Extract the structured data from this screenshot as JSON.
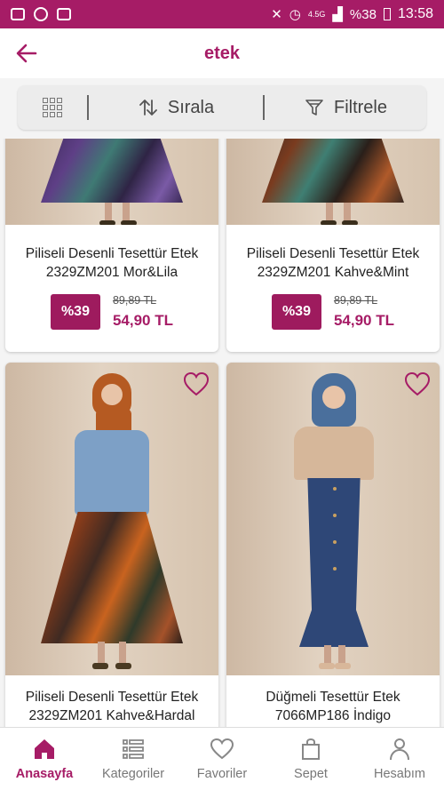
{
  "status_bar": {
    "network": "4.5G",
    "battery": "%38",
    "time": "13:58"
  },
  "header": {
    "title": "etek"
  },
  "toolbar": {
    "sort_label": "Sırala",
    "filter_label": "Filtrele"
  },
  "products": [
    {
      "name": "Piliseli Desenli Tesettür Etek 2329ZM201 Mor&Lila",
      "discount": "%39",
      "old_price": "89,89 TL",
      "new_price": "54,90 TL"
    },
    {
      "name": "Piliseli Desenli Tesettür Etek 2329ZM201 Kahve&Mint",
      "discount": "%39",
      "old_price": "89,89 TL",
      "new_price": "54,90 TL"
    },
    {
      "name": "Piliseli Desenli Tesettür Etek 2329ZM201 Kahve&Hardal"
    },
    {
      "name": "Düğmeli Tesettür Etek 7066MP186 İndigo"
    }
  ],
  "bottom_nav": [
    {
      "label": "Anasayfa",
      "icon": "home-icon",
      "active": true
    },
    {
      "label": "Kategoriler",
      "icon": "list-icon"
    },
    {
      "label": "Favoriler",
      "icon": "heart-icon"
    },
    {
      "label": "Sepet",
      "icon": "bag-icon"
    },
    {
      "label": "Hesabım",
      "icon": "user-icon"
    }
  ],
  "colors": {
    "brand": "#a61c66",
    "badge": "#9e1b5e"
  }
}
